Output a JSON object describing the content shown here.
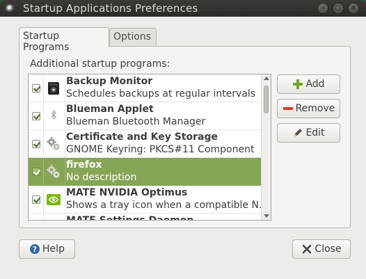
{
  "window": {
    "title": "Startup Applications Preferences"
  },
  "tabs": [
    {
      "label": "Startup Programs",
      "active": true
    },
    {
      "label": "Options",
      "active": false
    }
  ],
  "section_label": "Additional startup programs:",
  "programs": [
    {
      "name": "Backup Monitor",
      "description": "Schedules backups at regular intervals",
      "checked": true,
      "icon": "backup-monitor-icon",
      "selected": false
    },
    {
      "name": "Blueman Applet",
      "description": "Blueman Bluetooth Manager",
      "checked": true,
      "icon": "bluetooth-icon",
      "selected": false
    },
    {
      "name": "Certificate and Key Storage",
      "description": "GNOME Keyring: PKCS#11 Component",
      "checked": true,
      "icon": "gears-icon",
      "selected": false
    },
    {
      "name": "firefox",
      "description": "No description",
      "checked": true,
      "icon": "gears-icon",
      "selected": true
    },
    {
      "name": "MATE NVIDIA Optimus",
      "description": "Shows a tray icon when a compatible N...",
      "checked": true,
      "icon": "nvidia-icon",
      "selected": false
    },
    {
      "name": "MATE Settings Daemon",
      "description": "",
      "checked": true,
      "icon": "gears-icon",
      "selected": false
    }
  ],
  "buttons": {
    "add": "Add",
    "remove": "Remove",
    "edit": "Edit",
    "help": "Help",
    "close": "Close"
  },
  "colors": {
    "selection": "#87a556",
    "titlebar": "#2c2b28",
    "add_icon": "#6fa52a",
    "remove_icon": "#d23a2c"
  }
}
